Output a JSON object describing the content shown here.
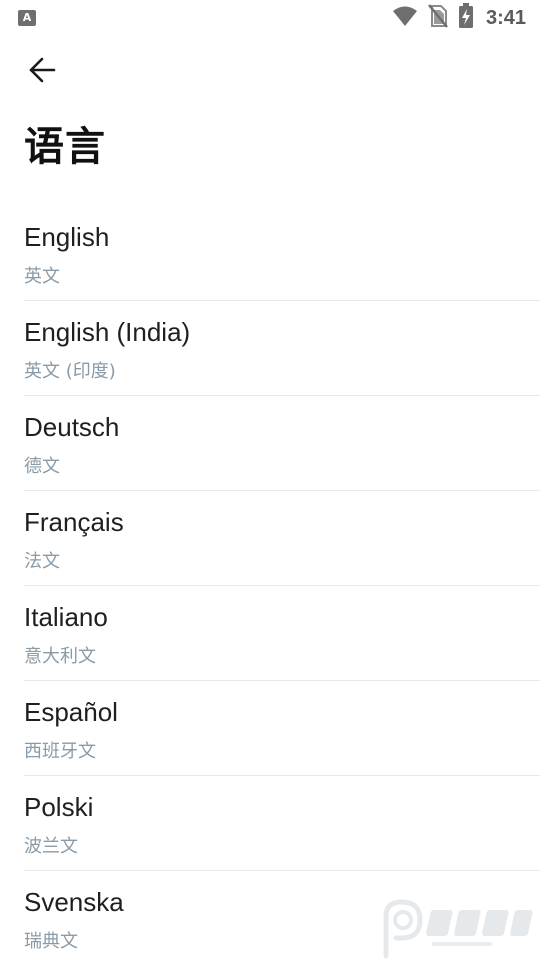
{
  "status_bar": {
    "left_icon": "A",
    "left_icon_name": "font-a-icon",
    "wifi_icon": "wifi-icon",
    "no_sim_icon": "no-sim-icon",
    "battery_icon": "battery-charging-icon",
    "time": "3:41"
  },
  "header": {
    "back_icon": "back-arrow-icon",
    "title": "语言"
  },
  "languages": [
    {
      "name": "English",
      "native": "英文"
    },
    {
      "name": "English (India)",
      "native": "英文 (印度)"
    },
    {
      "name": "Deutsch",
      "native": "德文"
    },
    {
      "name": "Français",
      "native": "法文"
    },
    {
      "name": "Italiano",
      "native": "意大利文"
    },
    {
      "name": "Español",
      "native": "西班牙文"
    },
    {
      "name": "Polski",
      "native": "波兰文"
    },
    {
      "name": "Svenska",
      "native": "瑞典文"
    }
  ],
  "watermark": {
    "logo_icon": "jingpin-logo-icon",
    "text": "精品下载"
  },
  "colors": {
    "title": "#111111",
    "item_text": "#1f1f1f",
    "item_subtext": "#8a9aa6",
    "divider": "#e9e9e9",
    "status_icons": "#6e6e6e"
  }
}
